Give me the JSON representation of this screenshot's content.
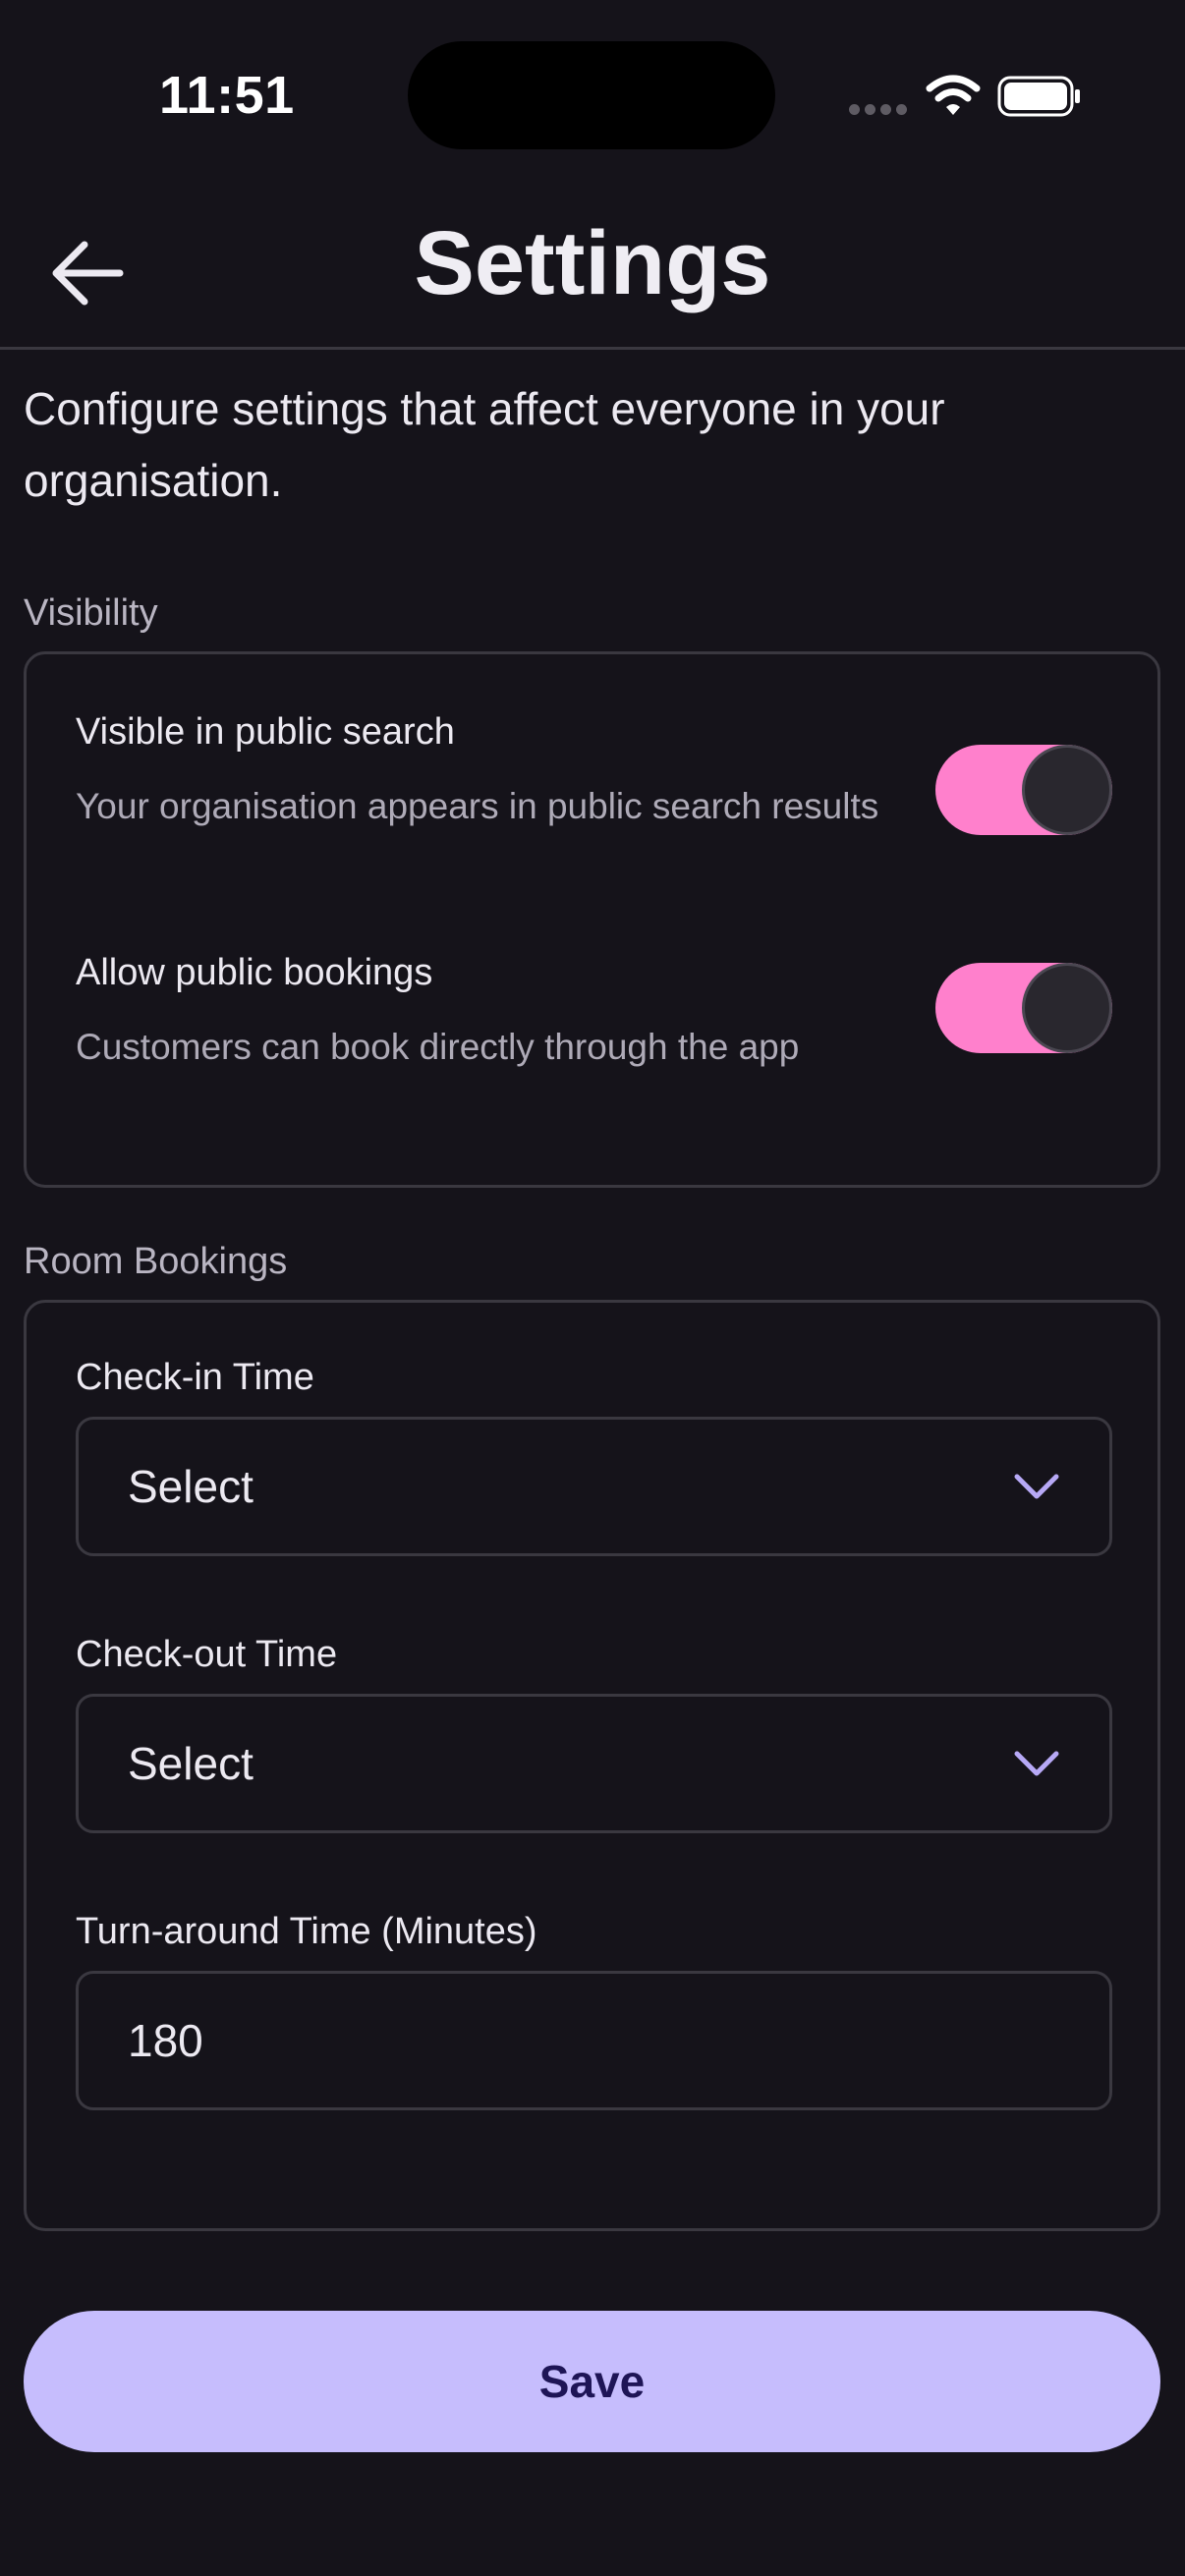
{
  "status_bar": {
    "time": "11:51",
    "signal_icon": "signal-dots-icon",
    "wifi_icon": "wifi-icon",
    "battery_icon": "battery-icon"
  },
  "header": {
    "title": "Settings",
    "back_icon": "arrow-left-icon"
  },
  "intro": "Configure settings that affect everyone in your organisation.",
  "visibility": {
    "label": "Visibility",
    "items": [
      {
        "title": "Visible in public search",
        "description": "Your organisation appears in public search results",
        "enabled": true
      },
      {
        "title": "Allow public bookings",
        "description": "Customers can book directly through the app",
        "enabled": true
      }
    ]
  },
  "room_bookings": {
    "label": "Room Bookings",
    "check_in": {
      "label": "Check-in Time",
      "value": "Select"
    },
    "check_out": {
      "label": "Check-out Time",
      "value": "Select"
    },
    "turnaround": {
      "label": "Turn-around Time (Minutes)",
      "value": "180"
    }
  },
  "save_label": "Save",
  "colors": {
    "background": "#15131a",
    "toggle_on": "#ff80cc",
    "accent": "#c6bdfd",
    "chevron": "#b7a9f6",
    "border": "#3a3840"
  }
}
